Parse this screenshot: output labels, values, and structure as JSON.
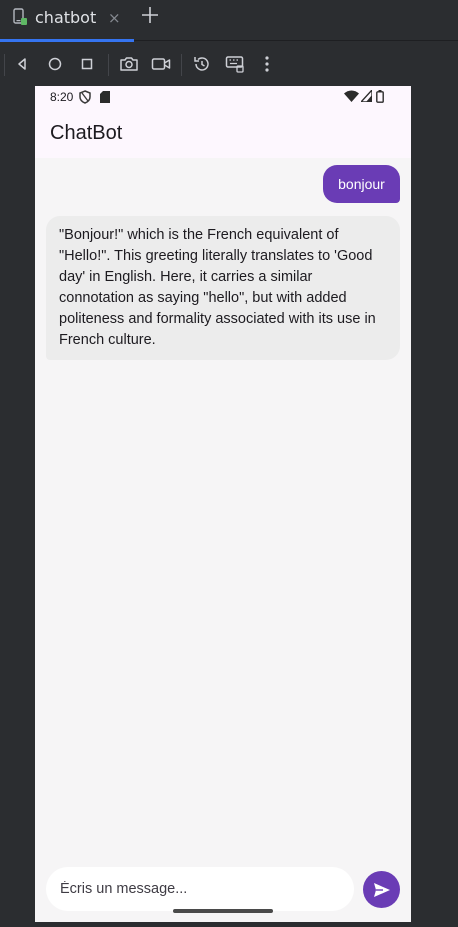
{
  "ide": {
    "tab": {
      "label": "chatbot",
      "close": "×"
    }
  },
  "device": {
    "status_bar": {
      "time": "8:20"
    },
    "app_bar": {
      "title": "ChatBot"
    },
    "messages": [
      {
        "role": "user",
        "text": "bonjour"
      },
      {
        "role": "bot",
        "text": "\"Bonjour!\" which is the French equivalent of \"Hello!\". This greeting literally translates to 'Good day' in English. Here, it carries a similar connotation as saying \"hello\", but with added politeness and formality associated with its use in French culture."
      }
    ],
    "composer": {
      "placeholder": "Écris un message..."
    }
  },
  "colors": {
    "accent": "#6a3cb5",
    "tab_underline": "#3574f0",
    "ide_bg": "#2b2d30",
    "app_bar_bg": "#fdf7fe",
    "screen_bg": "#f6f5f6",
    "bot_bubble_bg": "#ececec"
  },
  "icons": {
    "tab": "android-device-icon",
    "toolbar": [
      "back-icon",
      "home-icon",
      "overview-icon",
      "screenshot-icon",
      "screen-record-icon",
      "rotate-icon",
      "keyboard-settings-icon",
      "more-options-icon"
    ],
    "status": [
      "shield-icon",
      "sd-card-icon",
      "wifi-icon",
      "cell-signal-icon",
      "battery-icon"
    ],
    "send": "send-icon"
  }
}
